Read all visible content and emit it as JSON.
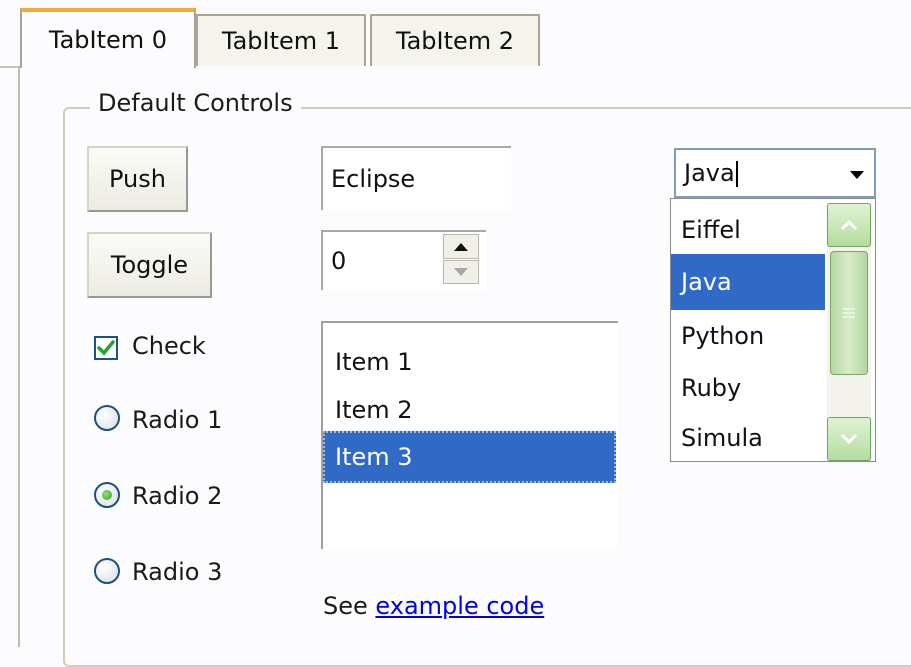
{
  "tabs": [
    {
      "label": "TabItem 0",
      "active": true
    },
    {
      "label": "TabItem 1",
      "active": false
    },
    {
      "label": "TabItem 2",
      "active": false
    }
  ],
  "group": {
    "title": "Default Controls"
  },
  "buttons": {
    "push": "Push",
    "toggle": "Toggle"
  },
  "text_field": {
    "value": "Eclipse"
  },
  "spinner": {
    "value": "0"
  },
  "checkbox": {
    "label": "Check",
    "checked": true
  },
  "radios": [
    {
      "label": "Radio 1",
      "selected": false
    },
    {
      "label": "Radio 2",
      "selected": true
    },
    {
      "label": "Radio 3",
      "selected": false
    }
  ],
  "list": {
    "items": [
      "Item 1",
      "Item 2",
      "Item 3"
    ],
    "selected_index": 2
  },
  "combo": {
    "value": "Java",
    "options": [
      "Eiffel",
      "Java",
      "Python",
      "Ruby",
      "Simula"
    ],
    "highlighted_index": 1
  },
  "footer": {
    "prefix": "See",
    "link": "example code"
  },
  "colors": {
    "selection": "#3169c6",
    "active_tab_accent": "#ecab3b",
    "link": "#0000e6",
    "scrollbar": "#b5dc9f"
  },
  "icons": {
    "check": "checkmark-icon",
    "combo": "chevron-down-icon",
    "scroll_up": "arrow-up-icon",
    "scroll_down": "arrow-down-icon"
  }
}
